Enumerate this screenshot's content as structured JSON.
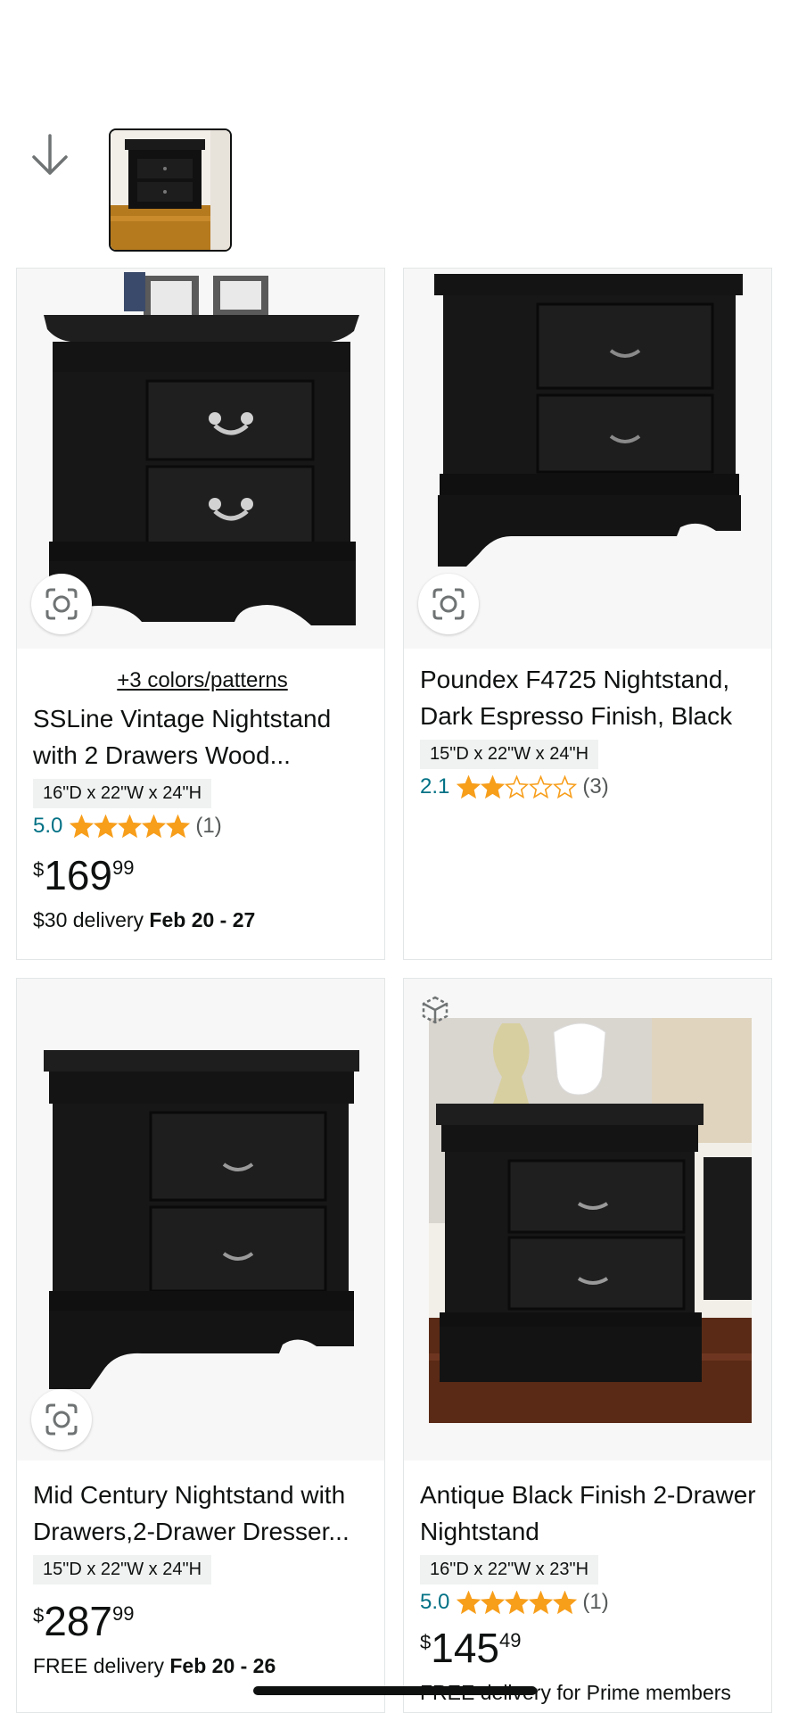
{
  "products": [
    {
      "colors_link": "+3 colors/patterns",
      "title": "SSLine Vintage Nightstand with 2 Drawers Wood...",
      "dimensions": "16\"D x 22\"W x 24\"H",
      "rating": "5.0",
      "stars": 5,
      "review_count": "(1)",
      "price_symbol": "$",
      "price_whole": "169",
      "price_fraction": "99",
      "delivery_prefix": "$30 delivery ",
      "delivery_date": "Feb 20 - 27"
    },
    {
      "title": "Poundex F4725 Nightstand, Dark Espresso Finish, Black",
      "dimensions": "15\"D x 22\"W x 24\"H",
      "rating": "2.1",
      "stars": 2,
      "review_count": "(3)"
    },
    {
      "title": "Mid Century Nightstand with Drawers,2-Drawer Dresser...",
      "dimensions": "15\"D x 22\"W x 24\"H",
      "price_symbol": "$",
      "price_whole": "287",
      "price_fraction": "99",
      "delivery_prefix": "FREE delivery ",
      "delivery_date": "Feb 20 - 26"
    },
    {
      "title": "Antique Black Finish 2-Drawer Nightstand",
      "dimensions": "16\"D x 22\"W x 23\"H",
      "rating": "5.0",
      "stars": 5,
      "review_count": "(1)",
      "price_symbol": "$",
      "price_whole": "145",
      "price_fraction": "49",
      "delivery_text": "FREE delivery for Prime members"
    }
  ],
  "icons": {
    "scroll": "down-arrow-icon",
    "visual_search": "camera-lens-icon",
    "view_in_room": "3d-cube-icon",
    "star": "star-icon"
  },
  "colors": {
    "star_fill": "#f79e1b",
    "link_teal": "#007185",
    "border": "#e3e6e6",
    "image_bg": "#f7f7f7"
  }
}
